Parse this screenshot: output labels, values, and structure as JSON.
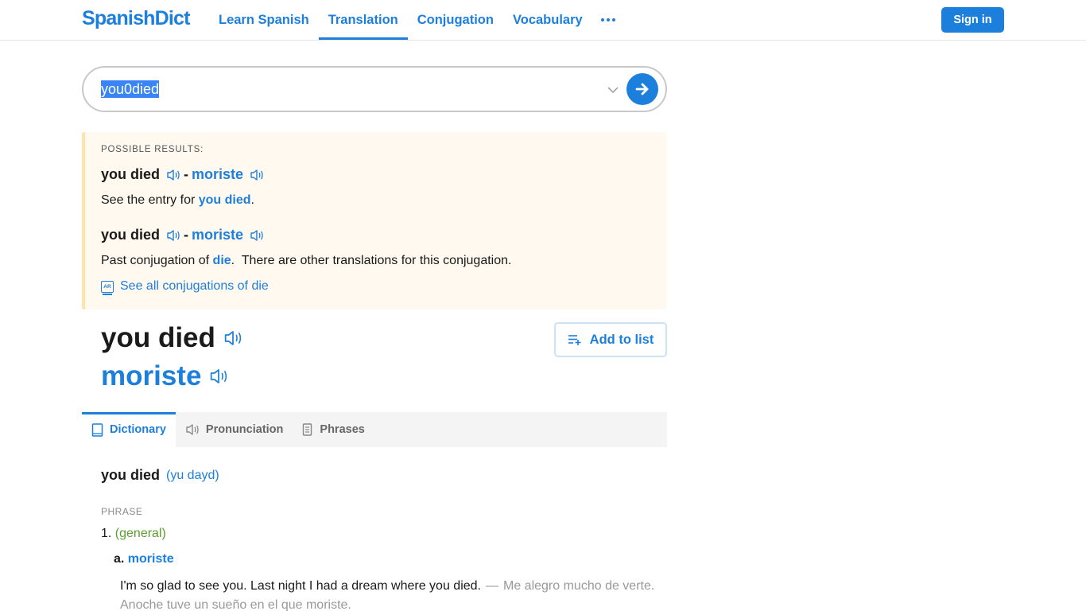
{
  "header": {
    "logo": "SpanishDict",
    "nav": [
      {
        "label": "Learn Spanish",
        "active": false
      },
      {
        "label": "Translation",
        "active": true
      },
      {
        "label": "Conjugation",
        "active": false
      },
      {
        "label": "Vocabulary",
        "active": false
      }
    ],
    "more_icon": "more-dots-icon",
    "signin_label": "Sign in"
  },
  "search": {
    "value": "you0died",
    "chevron_icon": "chevron-down-icon",
    "submit_icon": "arrow-right-icon"
  },
  "possible_results": {
    "label": "POSSIBLE RESULTS:",
    "items": [
      {
        "english": "you died",
        "spanish": "moriste",
        "text_prefix": "See the entry for ",
        "link": "you died",
        "text_suffix": "."
      },
      {
        "english": "you died",
        "spanish": "moriste",
        "text_prefix": "Past conjugation of ",
        "link": "die",
        "text_suffix": ".  There are other translations for this conjugation."
      }
    ],
    "see_all_label": "See all conjugations of die",
    "see_all_icon_text": "AR"
  },
  "headword": {
    "english": "you died",
    "spanish": "moriste",
    "add_to_list_label": "Add to list"
  },
  "tabs": [
    {
      "label": "Dictionary",
      "icon": "book-icon",
      "active": true
    },
    {
      "label": "Pronunciation",
      "icon": "speaker-icon",
      "active": false
    },
    {
      "label": "Phrases",
      "icon": "document-icon",
      "active": false
    }
  ],
  "entry": {
    "word": "you died",
    "pronunciation": "(yu dayd)",
    "part_of_speech": "PHRASE",
    "senses": [
      {
        "number": "1.",
        "context": "(general)",
        "translations": [
          {
            "letter": "a.",
            "word": "moriste",
            "example_en": "I'm so glad to see you. Last night I had a dream where you died.",
            "example_dash": "—",
            "example_es": "Me alegro mucho de verte. Anoche tuve un sueño en el que moriste."
          }
        ]
      }
    ]
  },
  "colors": {
    "brand": "#1d7fdc",
    "results_bg": "#fff9ef",
    "results_border": "#fde3a8",
    "context_green": "#5a9e2f"
  }
}
